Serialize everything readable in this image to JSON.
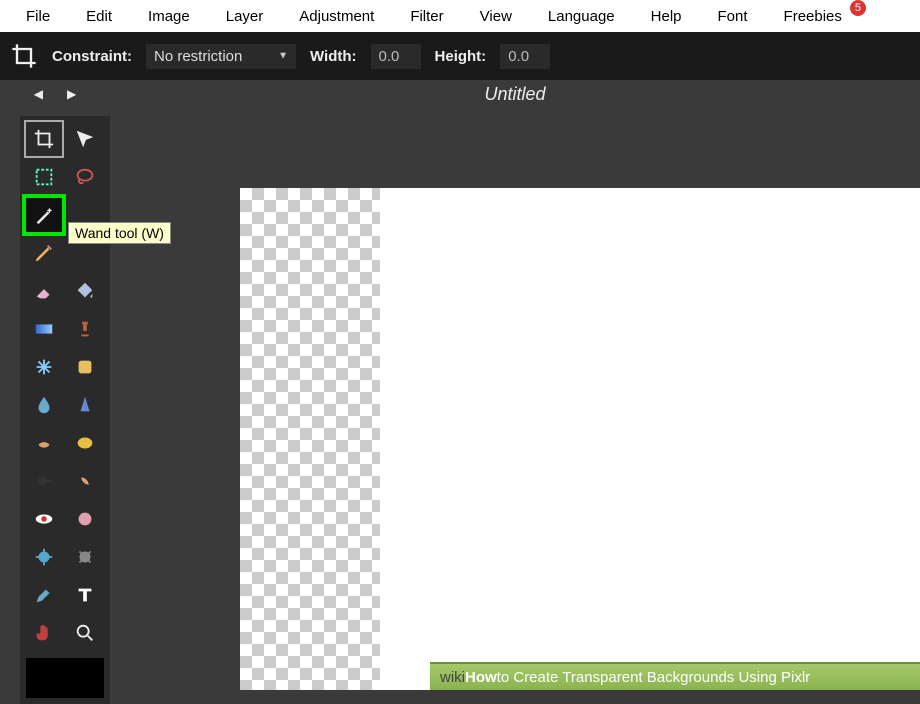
{
  "menu": {
    "items": [
      "File",
      "Edit",
      "Image",
      "Layer",
      "Adjustment",
      "Filter",
      "View",
      "Language",
      "Help",
      "Font",
      "Freebies"
    ],
    "freebies_badge": "5"
  },
  "options": {
    "constraint_label": "Constraint:",
    "constraint_value": "No restriction",
    "width_label": "Width:",
    "width_value": "0.0",
    "height_label": "Height:",
    "height_value": "0.0"
  },
  "tabs": {
    "title": "Untitled"
  },
  "tooltip": "Wand tool (W)",
  "wikihow": {
    "wiki": "wiki",
    "how": "How",
    "rest": " to Create Transparent Backgrounds Using Pixlr"
  },
  "tools": [
    {
      "name": "crop-tool",
      "icon": "crop",
      "active": "crop"
    },
    {
      "name": "move-tool",
      "icon": "move"
    },
    {
      "name": "marquee-tool",
      "icon": "marquee"
    },
    {
      "name": "lasso-tool",
      "icon": "lasso"
    },
    {
      "name": "wand-tool",
      "icon": "wand",
      "highlighted": true,
      "span2": true
    },
    {
      "name": "pencil-tool",
      "icon": "pencil",
      "span2": true
    },
    {
      "name": "eraser-tool",
      "icon": "eraser"
    },
    {
      "name": "bucket-tool",
      "icon": "bucket"
    },
    {
      "name": "gradient-tool",
      "icon": "gradient"
    },
    {
      "name": "stamp-tool",
      "icon": "stamp"
    },
    {
      "name": "heal-tool",
      "icon": "heal"
    },
    {
      "name": "patch-tool",
      "icon": "patch"
    },
    {
      "name": "blur-tool",
      "icon": "blur"
    },
    {
      "name": "sharpen-tool",
      "icon": "sharpen"
    },
    {
      "name": "smudge-tool",
      "icon": "smudge"
    },
    {
      "name": "sponge-tool",
      "icon": "sponge"
    },
    {
      "name": "dodge-tool",
      "icon": "dodge"
    },
    {
      "name": "burn-tool",
      "icon": "burn"
    },
    {
      "name": "redeye-tool",
      "icon": "redeye"
    },
    {
      "name": "spot-tool",
      "icon": "spot"
    },
    {
      "name": "bloat-tool",
      "icon": "bloat"
    },
    {
      "name": "pinch-tool",
      "icon": "pinch"
    },
    {
      "name": "eyedropper-tool",
      "icon": "eyedropper"
    },
    {
      "name": "type-tool",
      "icon": "type"
    },
    {
      "name": "hand-tool",
      "icon": "hand"
    },
    {
      "name": "zoom-tool",
      "icon": "zoom"
    }
  ]
}
